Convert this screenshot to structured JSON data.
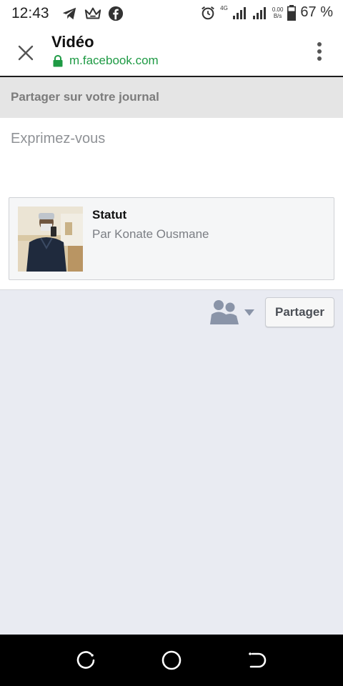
{
  "status_bar": {
    "time": "12:43",
    "network_label": "4G",
    "speed_value": "0.00",
    "speed_unit": "B/s",
    "battery_percent": "67 %",
    "icons": [
      "telegram-icon",
      "crown-icon",
      "facebook-icon",
      "alarm-icon",
      "signal-icon",
      "signal-icon",
      "battery-icon"
    ]
  },
  "browser": {
    "title": "Vidéo",
    "url": "m.facebook.com",
    "url_color": "#1e9a44"
  },
  "share": {
    "header": "Partager sur votre journal",
    "compose_placeholder": "Exprimez-vous",
    "card": {
      "title": "Statut",
      "author": "Par Konate Ousmane"
    },
    "submit_label": "Partager"
  },
  "colors": {
    "page_bg": "#e9ebf2",
    "header_bg": "#e5e5e5",
    "accent_text": "#4b4f56"
  }
}
